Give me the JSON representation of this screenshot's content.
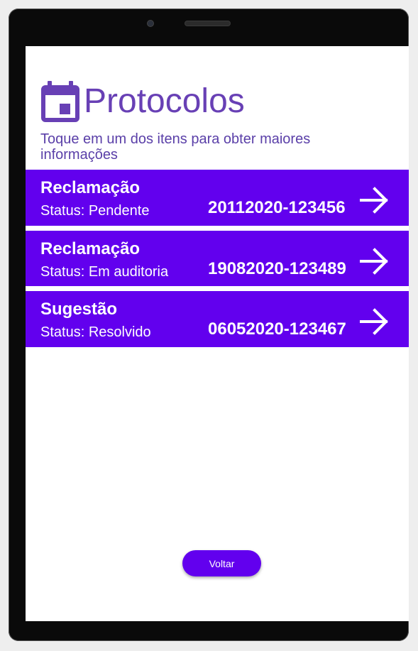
{
  "header": {
    "title": "Protocolos",
    "icon": "calendar-icon",
    "subtitle": "Toque em um dos itens para obter maiores informações"
  },
  "protocols": [
    {
      "type": "Reclamação",
      "status": "Status: Pendente",
      "number": "20112020-123456"
    },
    {
      "type": "Reclamação",
      "status": "Status: Em auditoria",
      "number": "19082020-123489"
    },
    {
      "type": "Sugestão",
      "status": "Status: Resolvido",
      "number": "06052020-123467"
    }
  ],
  "footer": {
    "back_label": "Voltar"
  },
  "colors": {
    "accent": "#6200ee",
    "title": "#6840b5",
    "device": "#0a0a0a"
  }
}
